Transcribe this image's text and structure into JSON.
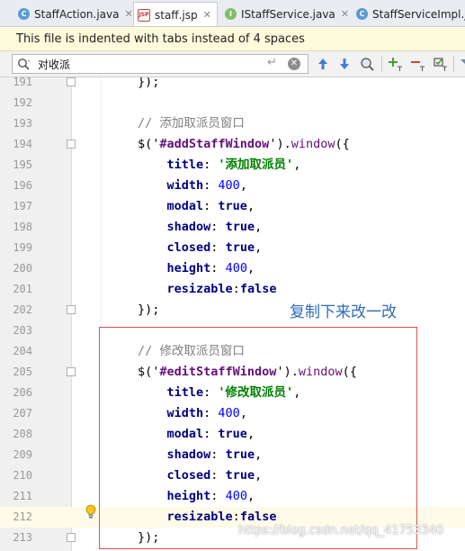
{
  "tabs": [
    {
      "label": "StaffAction.java",
      "icon": "java-class-icon",
      "active": false
    },
    {
      "label": "staff.jsp",
      "icon": "jsp-file-icon",
      "active": true
    },
    {
      "label": "IStaffService.java",
      "icon": "java-interface-icon",
      "active": false
    },
    {
      "label": "StaffServiceImpl.ja",
      "icon": "java-class-icon",
      "active": false
    }
  ],
  "notice": "This file is indented with tabs instead of 4 spaces",
  "search": {
    "value": "对收派",
    "enter_hint": "↵"
  },
  "annotation": {
    "text": "复制下来改一改"
  },
  "watermark": "https://blog.csdn.net/qq_41753340",
  "lines": [
    {
      "num": "191",
      "tokens": [
        {
          "t": "plain",
          "v": "});"
        }
      ]
    },
    {
      "num": "192",
      "tokens": []
    },
    {
      "num": "193",
      "tokens": [
        {
          "t": "comment",
          "v": "// 添加取派员窗口"
        }
      ]
    },
    {
      "num": "194",
      "tokens": [
        {
          "t": "plain",
          "v": "$('"
        },
        {
          "t": "id",
          "v": "#addStaffWindow"
        },
        {
          "t": "plain",
          "v": "')."
        },
        {
          "t": "fn",
          "v": "window"
        },
        {
          "t": "plain",
          "v": "({"
        }
      ]
    },
    {
      "num": "195",
      "tokens": [
        {
          "t": "plain",
          "v": "    "
        },
        {
          "t": "kw",
          "v": "title"
        },
        {
          "t": "plain",
          "v": ": "
        },
        {
          "t": "str",
          "v": "'添加取派员'"
        },
        {
          "t": "plain",
          "v": ","
        }
      ]
    },
    {
      "num": "196",
      "tokens": [
        {
          "t": "plain",
          "v": "    "
        },
        {
          "t": "kw",
          "v": "width"
        },
        {
          "t": "plain",
          "v": ": "
        },
        {
          "t": "num",
          "v": "400"
        },
        {
          "t": "plain",
          "v": ","
        }
      ]
    },
    {
      "num": "197",
      "tokens": [
        {
          "t": "plain",
          "v": "    "
        },
        {
          "t": "kw",
          "v": "modal"
        },
        {
          "t": "plain",
          "v": ": "
        },
        {
          "t": "bool",
          "v": "true"
        },
        {
          "t": "plain",
          "v": ","
        }
      ]
    },
    {
      "num": "198",
      "tokens": [
        {
          "t": "plain",
          "v": "    "
        },
        {
          "t": "kw",
          "v": "shadow"
        },
        {
          "t": "plain",
          "v": ": "
        },
        {
          "t": "bool",
          "v": "true"
        },
        {
          "t": "plain",
          "v": ","
        }
      ]
    },
    {
      "num": "199",
      "tokens": [
        {
          "t": "plain",
          "v": "    "
        },
        {
          "t": "kw",
          "v": "closed"
        },
        {
          "t": "plain",
          "v": ": "
        },
        {
          "t": "bool",
          "v": "true"
        },
        {
          "t": "plain",
          "v": ","
        }
      ]
    },
    {
      "num": "200",
      "tokens": [
        {
          "t": "plain",
          "v": "    "
        },
        {
          "t": "kw",
          "v": "height"
        },
        {
          "t": "plain",
          "v": ": "
        },
        {
          "t": "num",
          "v": "400"
        },
        {
          "t": "plain",
          "v": ","
        }
      ]
    },
    {
      "num": "201",
      "tokens": [
        {
          "t": "plain",
          "v": "    "
        },
        {
          "t": "kw",
          "v": "resizable"
        },
        {
          "t": "plain",
          "v": ":"
        },
        {
          "t": "bool",
          "v": "false"
        }
      ]
    },
    {
      "num": "202",
      "tokens": [
        {
          "t": "plain",
          "v": "});"
        }
      ]
    },
    {
      "num": "203",
      "tokens": []
    },
    {
      "num": "204",
      "tokens": [
        {
          "t": "comment",
          "v": "// 修改取派员窗口"
        }
      ]
    },
    {
      "num": "205",
      "tokens": [
        {
          "t": "plain",
          "v": "$('"
        },
        {
          "t": "id",
          "v": "#editStaffWindow"
        },
        {
          "t": "plain",
          "v": "')."
        },
        {
          "t": "fn",
          "v": "window"
        },
        {
          "t": "plain",
          "v": "({"
        }
      ]
    },
    {
      "num": "206",
      "tokens": [
        {
          "t": "plain",
          "v": "    "
        },
        {
          "t": "kw",
          "v": "title"
        },
        {
          "t": "plain",
          "v": ": "
        },
        {
          "t": "str",
          "v": "'修改取派员'"
        },
        {
          "t": "plain",
          "v": ","
        }
      ]
    },
    {
      "num": "207",
      "tokens": [
        {
          "t": "plain",
          "v": "    "
        },
        {
          "t": "kw",
          "v": "width"
        },
        {
          "t": "plain",
          "v": ": "
        },
        {
          "t": "num",
          "v": "400"
        },
        {
          "t": "plain",
          "v": ","
        }
      ]
    },
    {
      "num": "208",
      "tokens": [
        {
          "t": "plain",
          "v": "    "
        },
        {
          "t": "kw",
          "v": "modal"
        },
        {
          "t": "plain",
          "v": ": "
        },
        {
          "t": "bool",
          "v": "true"
        },
        {
          "t": "plain",
          "v": ","
        }
      ]
    },
    {
      "num": "209",
      "tokens": [
        {
          "t": "plain",
          "v": "    "
        },
        {
          "t": "kw",
          "v": "shadow"
        },
        {
          "t": "plain",
          "v": ": "
        },
        {
          "t": "bool",
          "v": "true"
        },
        {
          "t": "plain",
          "v": ","
        }
      ]
    },
    {
      "num": "210",
      "tokens": [
        {
          "t": "plain",
          "v": "    "
        },
        {
          "t": "kw",
          "v": "closed"
        },
        {
          "t": "plain",
          "v": ": "
        },
        {
          "t": "bool",
          "v": "true"
        },
        {
          "t": "plain",
          "v": ","
        }
      ]
    },
    {
      "num": "211",
      "tokens": [
        {
          "t": "plain",
          "v": "    "
        },
        {
          "t": "kw",
          "v": "height"
        },
        {
          "t": "plain",
          "v": ": "
        },
        {
          "t": "num",
          "v": "400"
        },
        {
          "t": "plain",
          "v": ","
        }
      ]
    },
    {
      "num": "212",
      "tokens": [
        {
          "t": "plain",
          "v": "    "
        },
        {
          "t": "kw",
          "v": "resizable"
        },
        {
          "t": "plain",
          "v": ":"
        },
        {
          "t": "bool",
          "v": "false"
        }
      ],
      "highlight": true
    },
    {
      "num": "213",
      "tokens": [
        {
          "t": "plain",
          "v": "});"
        }
      ]
    }
  ]
}
